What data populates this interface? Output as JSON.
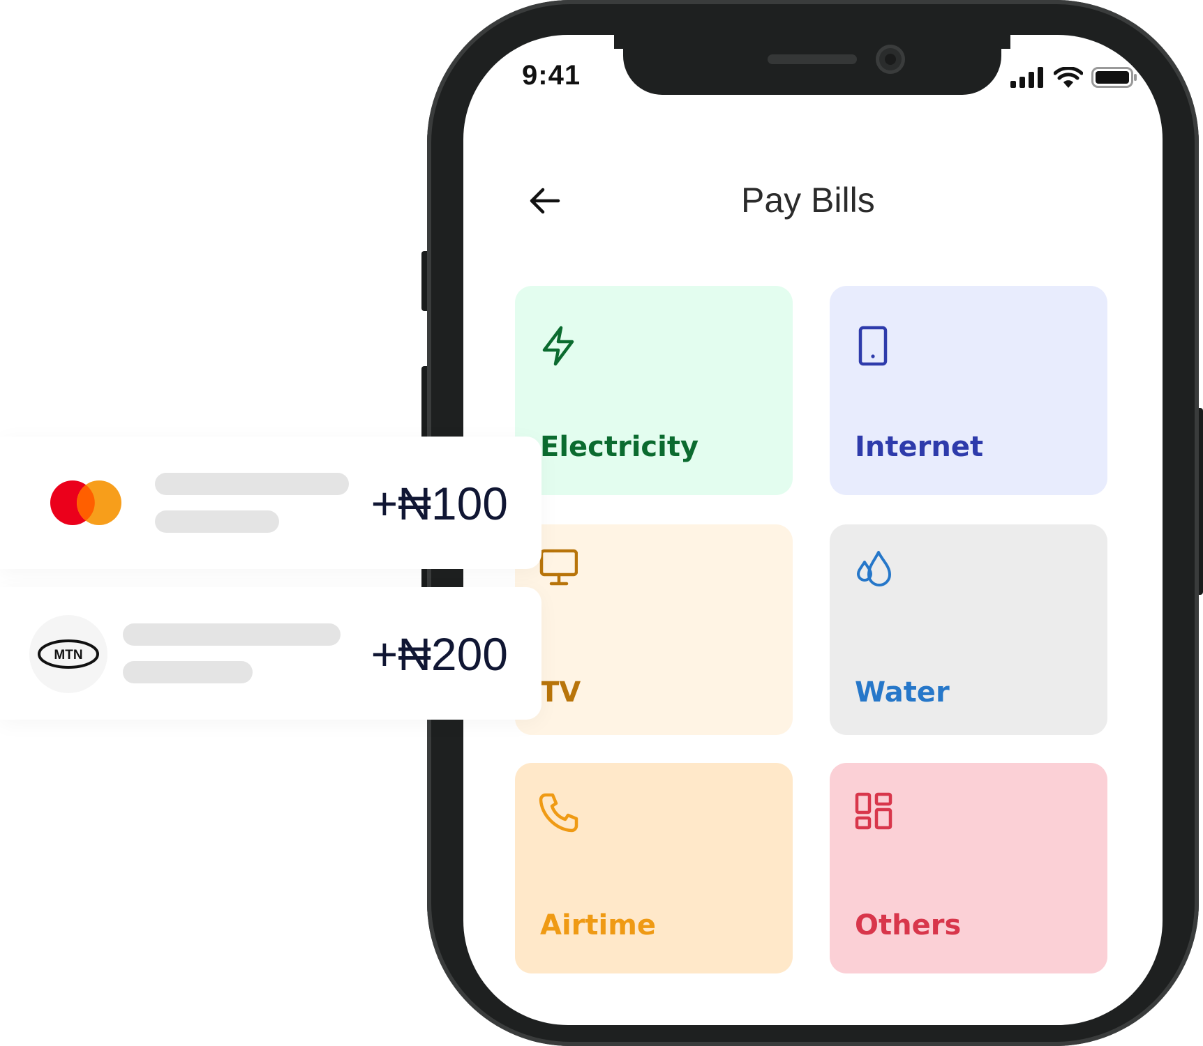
{
  "status_bar": {
    "time": "9:41"
  },
  "header": {
    "title": "Pay Bills"
  },
  "tiles": [
    {
      "label": "Electricity",
      "icon": "lightning-icon",
      "bg": "#e3fdef",
      "color": "#0b6b2f"
    },
    {
      "label": "Internet",
      "icon": "tablet-icon",
      "bg": "#e8ecfd",
      "color": "#2e3bab"
    },
    {
      "label": "TV",
      "icon": "monitor-icon",
      "bg": "#fff4e4",
      "color": "#b8740a"
    },
    {
      "label": "Water",
      "icon": "water-drops-icon",
      "bg": "#ececec",
      "color": "#2677c9"
    },
    {
      "label": "Airtime",
      "icon": "phone-icon",
      "bg": "#ffe8c9",
      "color": "#ef9a14"
    },
    {
      "label": "Others",
      "icon": "grid-icon",
      "bg": "#fbd0d6",
      "color": "#d8364b"
    }
  ],
  "transactions": [
    {
      "logo": "mastercard-logo",
      "amount": "+₦100"
    },
    {
      "logo": "mtn-logo",
      "logo_text": "MTN",
      "amount": "+₦200"
    }
  ]
}
